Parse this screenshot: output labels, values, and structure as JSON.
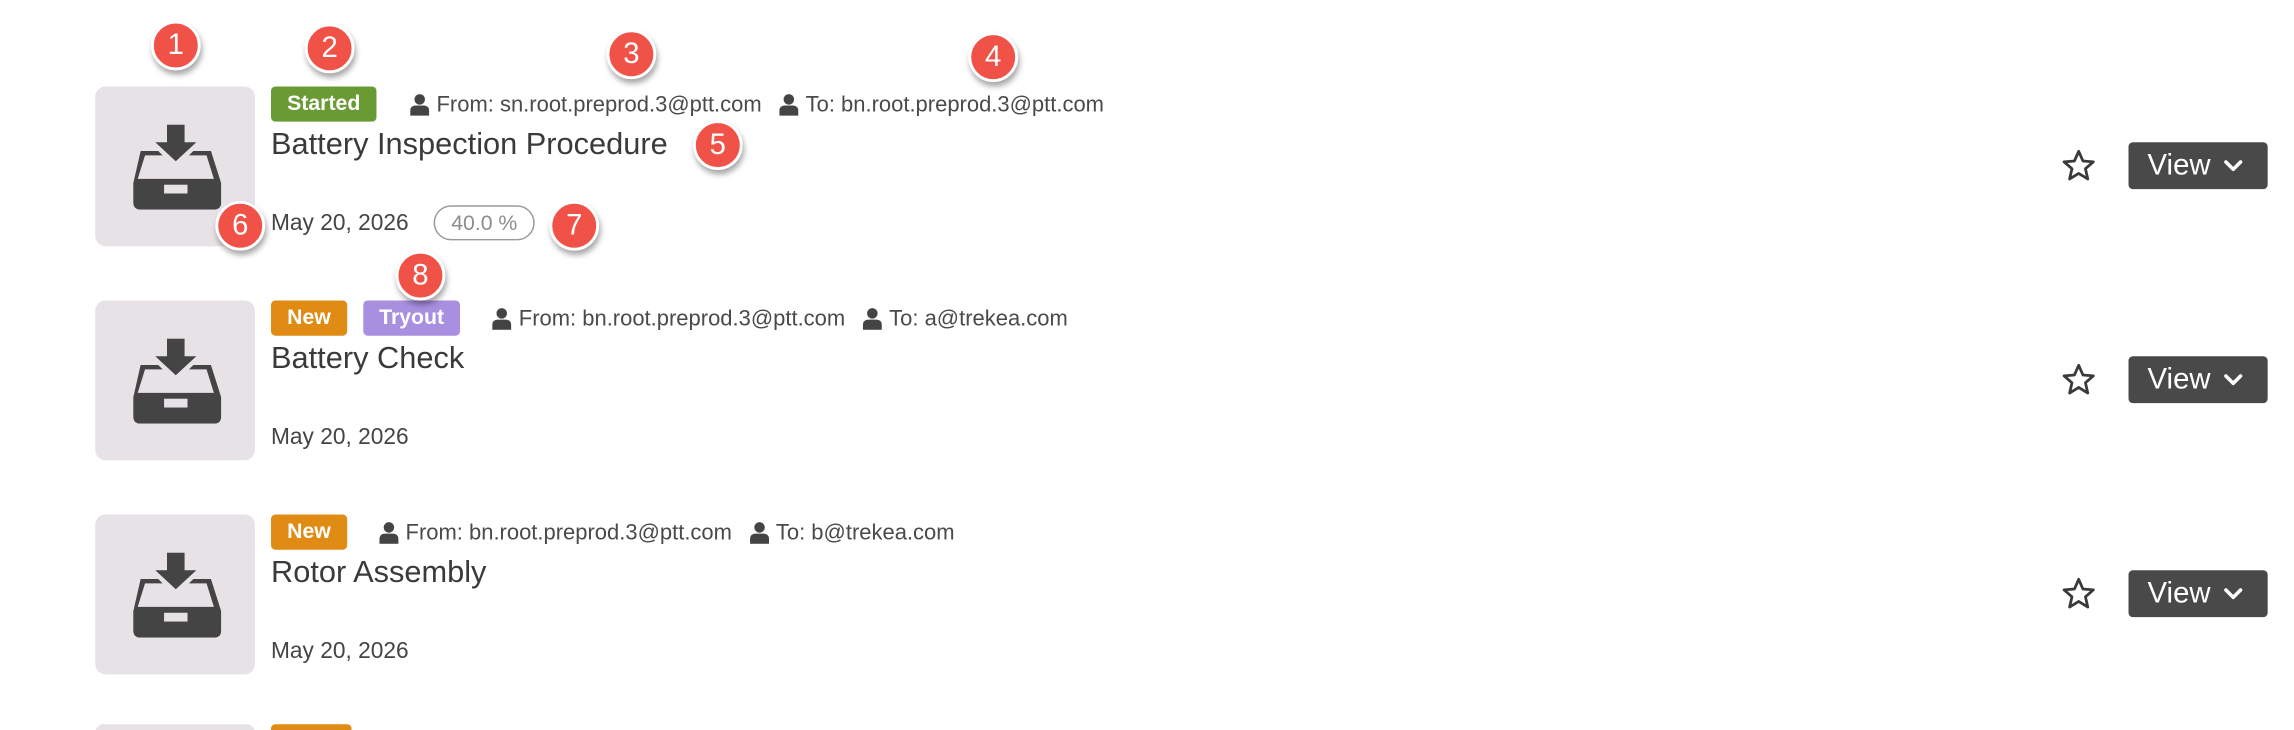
{
  "colors": {
    "started": "#6a9a34",
    "new": "#e08c14",
    "tryout": "#a98fe0",
    "callout": "#f05248",
    "view_button": "#494949",
    "thumb_bg": "#e6e2e6"
  },
  "icons": {
    "thumbnail": "inbox-download-icon",
    "person": "user-icon",
    "favorite": "star-outline-icon",
    "dropdown": "chevron-down-icon"
  },
  "rows": [
    {
      "badges": [
        {
          "label": "Started",
          "color": "#6a9a34"
        }
      ],
      "from": "From: sn.root.preprod.3@ptt.com",
      "to": "To: bn.root.preprod.3@ptt.com",
      "title": "Battery Inspection Procedure",
      "date": "May 20, 2026",
      "progress": "40.0 %",
      "view_label": "View"
    },
    {
      "badges": [
        {
          "label": "New",
          "color": "#e08c14"
        },
        {
          "label": "Tryout",
          "color": "#a98fe0"
        }
      ],
      "from": "From: bn.root.preprod.3@ptt.com",
      "to": "To: a@trekea.com",
      "title": "Battery Check",
      "date": "May 20, 2026",
      "view_label": "View"
    },
    {
      "badges": [
        {
          "label": "New",
          "color": "#e08c14"
        }
      ],
      "from": "From: bn.root.preprod.3@ptt.com",
      "to": "To: b@trekea.com",
      "title": "Rotor Assembly",
      "date": "May 20, 2026",
      "view_label": "View"
    }
  ],
  "callouts": [
    "1",
    "2",
    "3",
    "4",
    "5",
    "6",
    "7",
    "8"
  ]
}
